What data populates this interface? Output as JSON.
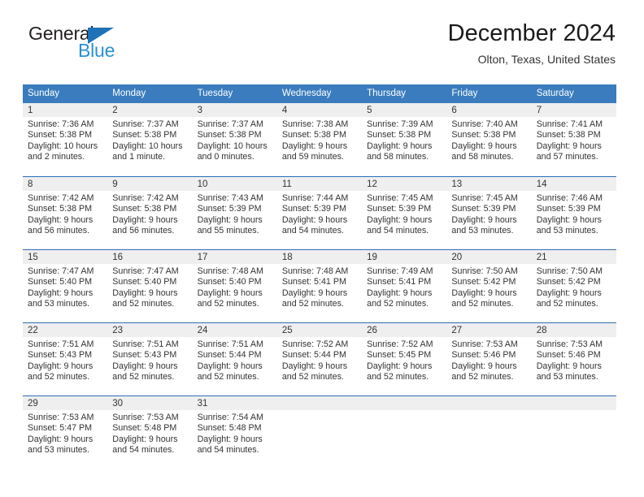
{
  "brand": {
    "name_dark": "General",
    "name_light": "Blue",
    "triangle_color": "#1f72b8",
    "light_color": "#2a8fd4"
  },
  "header": {
    "title": "December 2024",
    "location": "Olton, Texas, United States"
  },
  "calendar": {
    "header_bg": "#3a7cbe",
    "day_band_bg": "#efefef",
    "weekdays": [
      "Sunday",
      "Monday",
      "Tuesday",
      "Wednesday",
      "Thursday",
      "Friday",
      "Saturday"
    ],
    "weeks": [
      [
        {
          "day": "1",
          "sunrise": "Sunrise: 7:36 AM",
          "sunset": "Sunset: 5:38 PM",
          "daylight_1": "Daylight: 10 hours",
          "daylight_2": "and 2 minutes."
        },
        {
          "day": "2",
          "sunrise": "Sunrise: 7:37 AM",
          "sunset": "Sunset: 5:38 PM",
          "daylight_1": "Daylight: 10 hours",
          "daylight_2": "and 1 minute."
        },
        {
          "day": "3",
          "sunrise": "Sunrise: 7:37 AM",
          "sunset": "Sunset: 5:38 PM",
          "daylight_1": "Daylight: 10 hours",
          "daylight_2": "and 0 minutes."
        },
        {
          "day": "4",
          "sunrise": "Sunrise: 7:38 AM",
          "sunset": "Sunset: 5:38 PM",
          "daylight_1": "Daylight: 9 hours",
          "daylight_2": "and 59 minutes."
        },
        {
          "day": "5",
          "sunrise": "Sunrise: 7:39 AM",
          "sunset": "Sunset: 5:38 PM",
          "daylight_1": "Daylight: 9 hours",
          "daylight_2": "and 58 minutes."
        },
        {
          "day": "6",
          "sunrise": "Sunrise: 7:40 AM",
          "sunset": "Sunset: 5:38 PM",
          "daylight_1": "Daylight: 9 hours",
          "daylight_2": "and 58 minutes."
        },
        {
          "day": "7",
          "sunrise": "Sunrise: 7:41 AM",
          "sunset": "Sunset: 5:38 PM",
          "daylight_1": "Daylight: 9 hours",
          "daylight_2": "and 57 minutes."
        }
      ],
      [
        {
          "day": "8",
          "sunrise": "Sunrise: 7:42 AM",
          "sunset": "Sunset: 5:38 PM",
          "daylight_1": "Daylight: 9 hours",
          "daylight_2": "and 56 minutes."
        },
        {
          "day": "9",
          "sunrise": "Sunrise: 7:42 AM",
          "sunset": "Sunset: 5:38 PM",
          "daylight_1": "Daylight: 9 hours",
          "daylight_2": "and 56 minutes."
        },
        {
          "day": "10",
          "sunrise": "Sunrise: 7:43 AM",
          "sunset": "Sunset: 5:39 PM",
          "daylight_1": "Daylight: 9 hours",
          "daylight_2": "and 55 minutes."
        },
        {
          "day": "11",
          "sunrise": "Sunrise: 7:44 AM",
          "sunset": "Sunset: 5:39 PM",
          "daylight_1": "Daylight: 9 hours",
          "daylight_2": "and 54 minutes."
        },
        {
          "day": "12",
          "sunrise": "Sunrise: 7:45 AM",
          "sunset": "Sunset: 5:39 PM",
          "daylight_1": "Daylight: 9 hours",
          "daylight_2": "and 54 minutes."
        },
        {
          "day": "13",
          "sunrise": "Sunrise: 7:45 AM",
          "sunset": "Sunset: 5:39 PM",
          "daylight_1": "Daylight: 9 hours",
          "daylight_2": "and 53 minutes."
        },
        {
          "day": "14",
          "sunrise": "Sunrise: 7:46 AM",
          "sunset": "Sunset: 5:39 PM",
          "daylight_1": "Daylight: 9 hours",
          "daylight_2": "and 53 minutes."
        }
      ],
      [
        {
          "day": "15",
          "sunrise": "Sunrise: 7:47 AM",
          "sunset": "Sunset: 5:40 PM",
          "daylight_1": "Daylight: 9 hours",
          "daylight_2": "and 53 minutes."
        },
        {
          "day": "16",
          "sunrise": "Sunrise: 7:47 AM",
          "sunset": "Sunset: 5:40 PM",
          "daylight_1": "Daylight: 9 hours",
          "daylight_2": "and 52 minutes."
        },
        {
          "day": "17",
          "sunrise": "Sunrise: 7:48 AM",
          "sunset": "Sunset: 5:40 PM",
          "daylight_1": "Daylight: 9 hours",
          "daylight_2": "and 52 minutes."
        },
        {
          "day": "18",
          "sunrise": "Sunrise: 7:48 AM",
          "sunset": "Sunset: 5:41 PM",
          "daylight_1": "Daylight: 9 hours",
          "daylight_2": "and 52 minutes."
        },
        {
          "day": "19",
          "sunrise": "Sunrise: 7:49 AM",
          "sunset": "Sunset: 5:41 PM",
          "daylight_1": "Daylight: 9 hours",
          "daylight_2": "and 52 minutes."
        },
        {
          "day": "20",
          "sunrise": "Sunrise: 7:50 AM",
          "sunset": "Sunset: 5:42 PM",
          "daylight_1": "Daylight: 9 hours",
          "daylight_2": "and 52 minutes."
        },
        {
          "day": "21",
          "sunrise": "Sunrise: 7:50 AM",
          "sunset": "Sunset: 5:42 PM",
          "daylight_1": "Daylight: 9 hours",
          "daylight_2": "and 52 minutes."
        }
      ],
      [
        {
          "day": "22",
          "sunrise": "Sunrise: 7:51 AM",
          "sunset": "Sunset: 5:43 PM",
          "daylight_1": "Daylight: 9 hours",
          "daylight_2": "and 52 minutes."
        },
        {
          "day": "23",
          "sunrise": "Sunrise: 7:51 AM",
          "sunset": "Sunset: 5:43 PM",
          "daylight_1": "Daylight: 9 hours",
          "daylight_2": "and 52 minutes."
        },
        {
          "day": "24",
          "sunrise": "Sunrise: 7:51 AM",
          "sunset": "Sunset: 5:44 PM",
          "daylight_1": "Daylight: 9 hours",
          "daylight_2": "and 52 minutes."
        },
        {
          "day": "25",
          "sunrise": "Sunrise: 7:52 AM",
          "sunset": "Sunset: 5:44 PM",
          "daylight_1": "Daylight: 9 hours",
          "daylight_2": "and 52 minutes."
        },
        {
          "day": "26",
          "sunrise": "Sunrise: 7:52 AM",
          "sunset": "Sunset: 5:45 PM",
          "daylight_1": "Daylight: 9 hours",
          "daylight_2": "and 52 minutes."
        },
        {
          "day": "27",
          "sunrise": "Sunrise: 7:53 AM",
          "sunset": "Sunset: 5:46 PM",
          "daylight_1": "Daylight: 9 hours",
          "daylight_2": "and 52 minutes."
        },
        {
          "day": "28",
          "sunrise": "Sunrise: 7:53 AM",
          "sunset": "Sunset: 5:46 PM",
          "daylight_1": "Daylight: 9 hours",
          "daylight_2": "and 53 minutes."
        }
      ],
      [
        {
          "day": "29",
          "sunrise": "Sunrise: 7:53 AM",
          "sunset": "Sunset: 5:47 PM",
          "daylight_1": "Daylight: 9 hours",
          "daylight_2": "and 53 minutes."
        },
        {
          "day": "30",
          "sunrise": "Sunrise: 7:53 AM",
          "sunset": "Sunset: 5:48 PM",
          "daylight_1": "Daylight: 9 hours",
          "daylight_2": "and 54 minutes."
        },
        {
          "day": "31",
          "sunrise": "Sunrise: 7:54 AM",
          "sunset": "Sunset: 5:48 PM",
          "daylight_1": "Daylight: 9 hours",
          "daylight_2": "and 54 minutes."
        },
        {
          "day": "",
          "sunrise": "",
          "sunset": "",
          "daylight_1": "",
          "daylight_2": ""
        },
        {
          "day": "",
          "sunrise": "",
          "sunset": "",
          "daylight_1": "",
          "daylight_2": ""
        },
        {
          "day": "",
          "sunrise": "",
          "sunset": "",
          "daylight_1": "",
          "daylight_2": ""
        },
        {
          "day": "",
          "sunrise": "",
          "sunset": "",
          "daylight_1": "",
          "daylight_2": ""
        }
      ]
    ]
  }
}
